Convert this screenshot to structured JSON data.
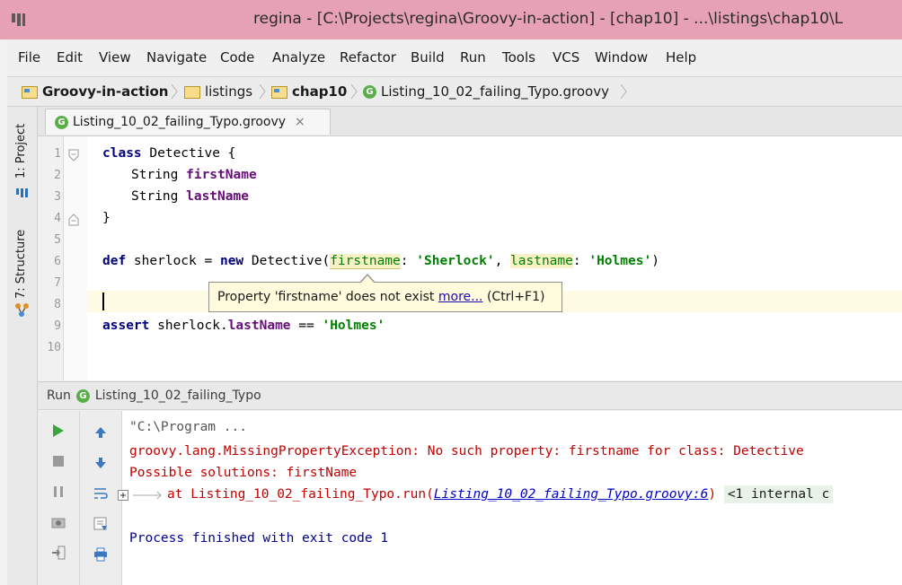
{
  "window": {
    "title": "regina - [C:\\Projects\\regina\\Groovy-in-action] - [chap10] - ...\\listings\\chap10\\L"
  },
  "menu": [
    "File",
    "Edit",
    "View",
    "Navigate",
    "Code",
    "Analyze",
    "Refactor",
    "Build",
    "Run",
    "Tools",
    "VCS",
    "Window",
    "Help"
  ],
  "breadcrumb": {
    "project": "Groovy-in-action",
    "folder1": "listings",
    "folder2": "chap10",
    "file": "Listing_10_02_failing_Typo.groovy"
  },
  "side_tabs": {
    "project": "1: Project",
    "structure": "7: Structure"
  },
  "editor": {
    "tab_label": "Listing_10_02_failing_Typo.groovy",
    "tab_close": "×",
    "line_numbers": [
      "1",
      "2",
      "3",
      "4",
      "5",
      "6",
      "7",
      "8",
      "9",
      "10"
    ],
    "code": {
      "l1_kw": "class",
      "l1_rest": " Detective {",
      "l2_type": "String ",
      "l2_field": "firstName",
      "l3_type": "String ",
      "l3_field": "lastName",
      "l4": "}",
      "l6_kw1": "def",
      "l6_a": " sherlock = ",
      "l6_kw2": "new",
      "l6_b": " Detective(",
      "l6_arg1": "firstname",
      "l6_c": ": ",
      "l6_str1": "'Sherlock'",
      "l6_d": ", ",
      "l6_arg2": "lastname",
      "l6_e": ": ",
      "l6_str2": "'Holmes'",
      "l6_f": ")",
      "l9_kw": "assert",
      "l9_a": " sherlock.",
      "l9_field": "lastName",
      "l9_b": " == ",
      "l9_str": "'Holmes'"
    }
  },
  "tooltip": {
    "message": "Property 'firstname' does not exist ",
    "link": "more...",
    "shortcut": " (Ctrl+F1)"
  },
  "run_panel": {
    "label": "Run",
    "config": "Listing_10_02_failing_Typo",
    "console": {
      "cmd": "\"C:\\Program ...",
      "error": "groovy.lang.MissingPropertyException: No such property: firstname for class: Detective",
      "solutions": "Possible solutions: firstName",
      "at_prefix": "at Listing_10_02_failing_Typo.run(",
      "at_link": "Listing_10_02_failing_Typo.groovy:6",
      "at_suffix": ")",
      "internal": "<1 internal c",
      "finished": "Process finished with exit code 1"
    }
  },
  "colors": {
    "titlebar": "#e6a2b4",
    "error_text": "#c10000",
    "string": "#008000",
    "keyword": "#000080",
    "field": "#660e7a"
  }
}
